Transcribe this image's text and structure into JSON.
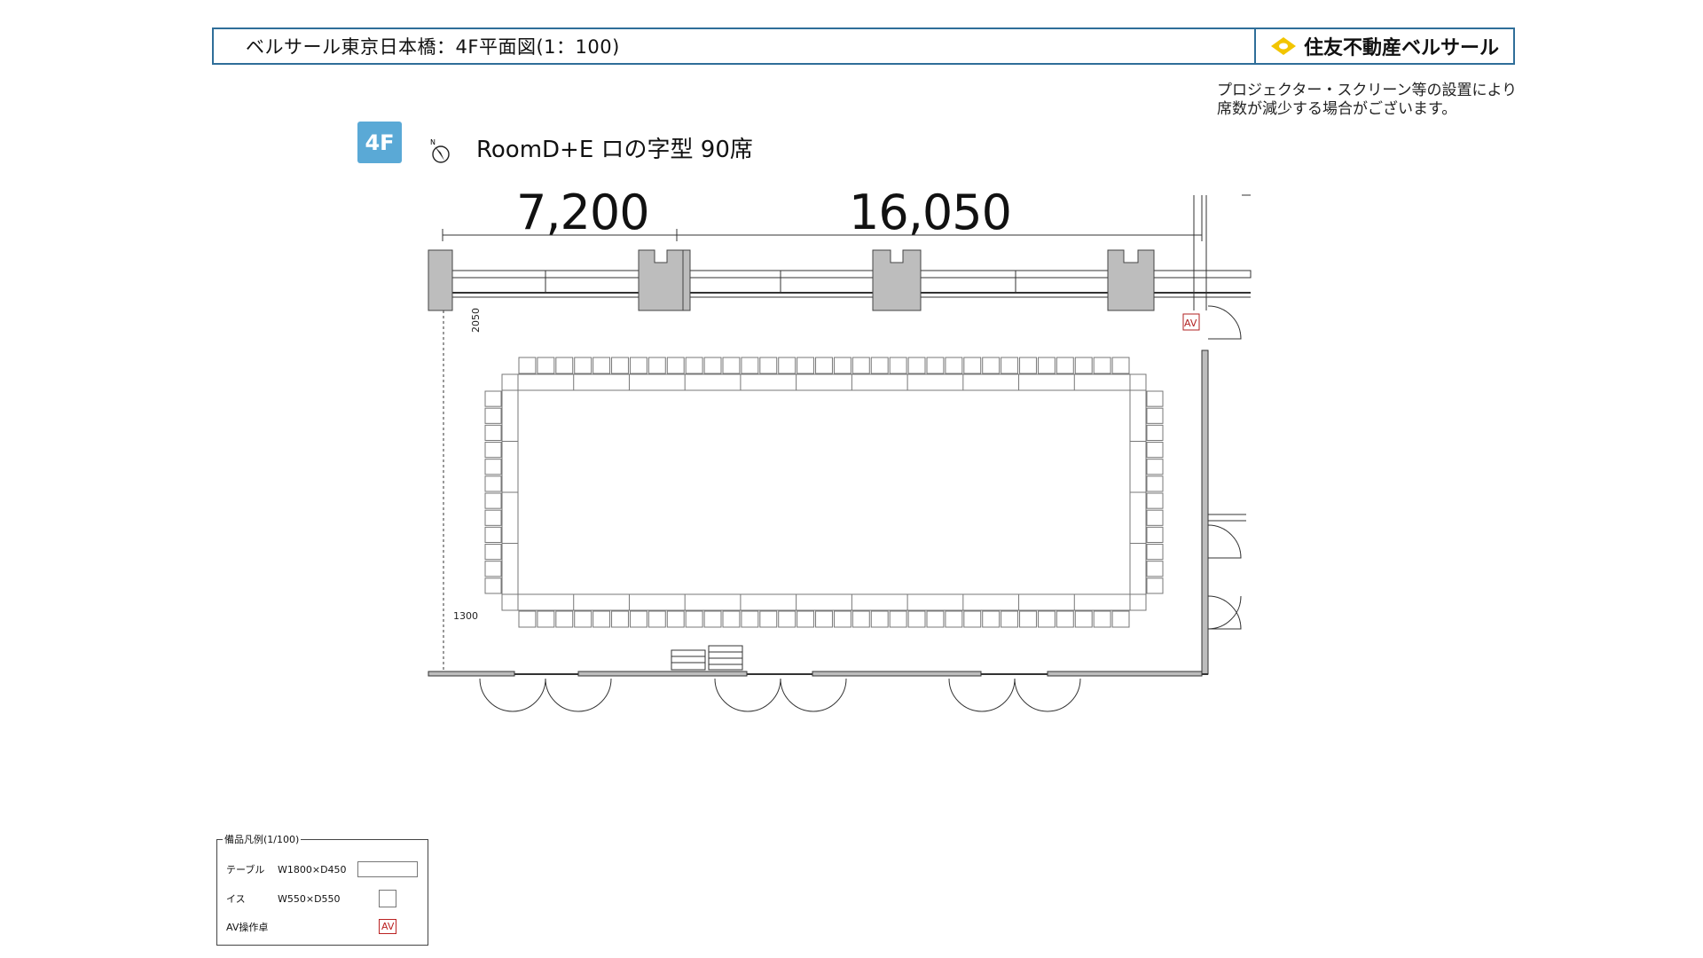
{
  "header": {
    "title": "ベルサール東京日本橋：4F平面図(1：100)",
    "logo_text": "住友不動産ベルサール"
  },
  "note": {
    "line1": "プロジェクター・スクリーン等の設置により",
    "line2": "席数が減少する場合がございます。"
  },
  "floor_badge": "4F",
  "compass_label": "N",
  "room_title": "RoomD+E ロの字型 90席",
  "dimensions": {
    "left": "7,200",
    "right": "16,050",
    "vertical_top": "2050",
    "vertical_bottom": "1300"
  },
  "av_label": "AV",
  "legend": {
    "title": "備品凡例(1/100)",
    "rows": [
      {
        "label": "テーブル",
        "size": "W1800×D450"
      },
      {
        "label": "イス",
        "size": "W550×D550"
      },
      {
        "label": "AV操作卓",
        "size": "",
        "symbol": "AV"
      }
    ]
  },
  "colors": {
    "header_border": "#2f6e99",
    "badge": "#5aa9d6",
    "logo_mark": "#f2c500",
    "av": "#b22222",
    "column": "#bdbdbd"
  }
}
